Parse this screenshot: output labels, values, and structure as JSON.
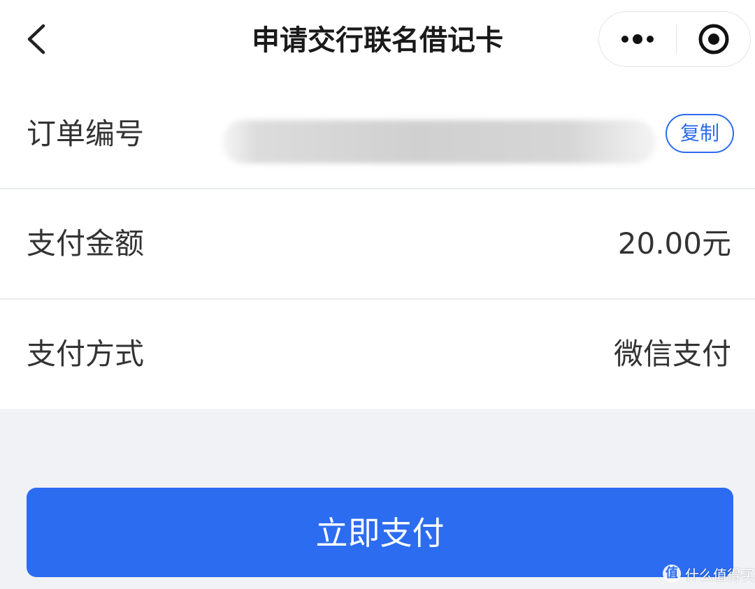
{
  "header": {
    "title": "申请交行联名借记卡",
    "back_icon": "chevron-left-icon",
    "more_icon": "more-dots-icon",
    "close_icon": "target-close-icon"
  },
  "order": {
    "order_no_label": "订单编号",
    "copy_label": "复制",
    "amount_label": "支付金额",
    "amount_value": "20.00元",
    "method_label": "支付方式",
    "method_value": "微信支付"
  },
  "actions": {
    "pay_label": "立即支付"
  },
  "watermark": {
    "logo_char": "值",
    "text": "什么值得买"
  },
  "colors": {
    "accent": "#2c6cf1",
    "background": "#f0f2f5",
    "card": "#ffffff"
  }
}
